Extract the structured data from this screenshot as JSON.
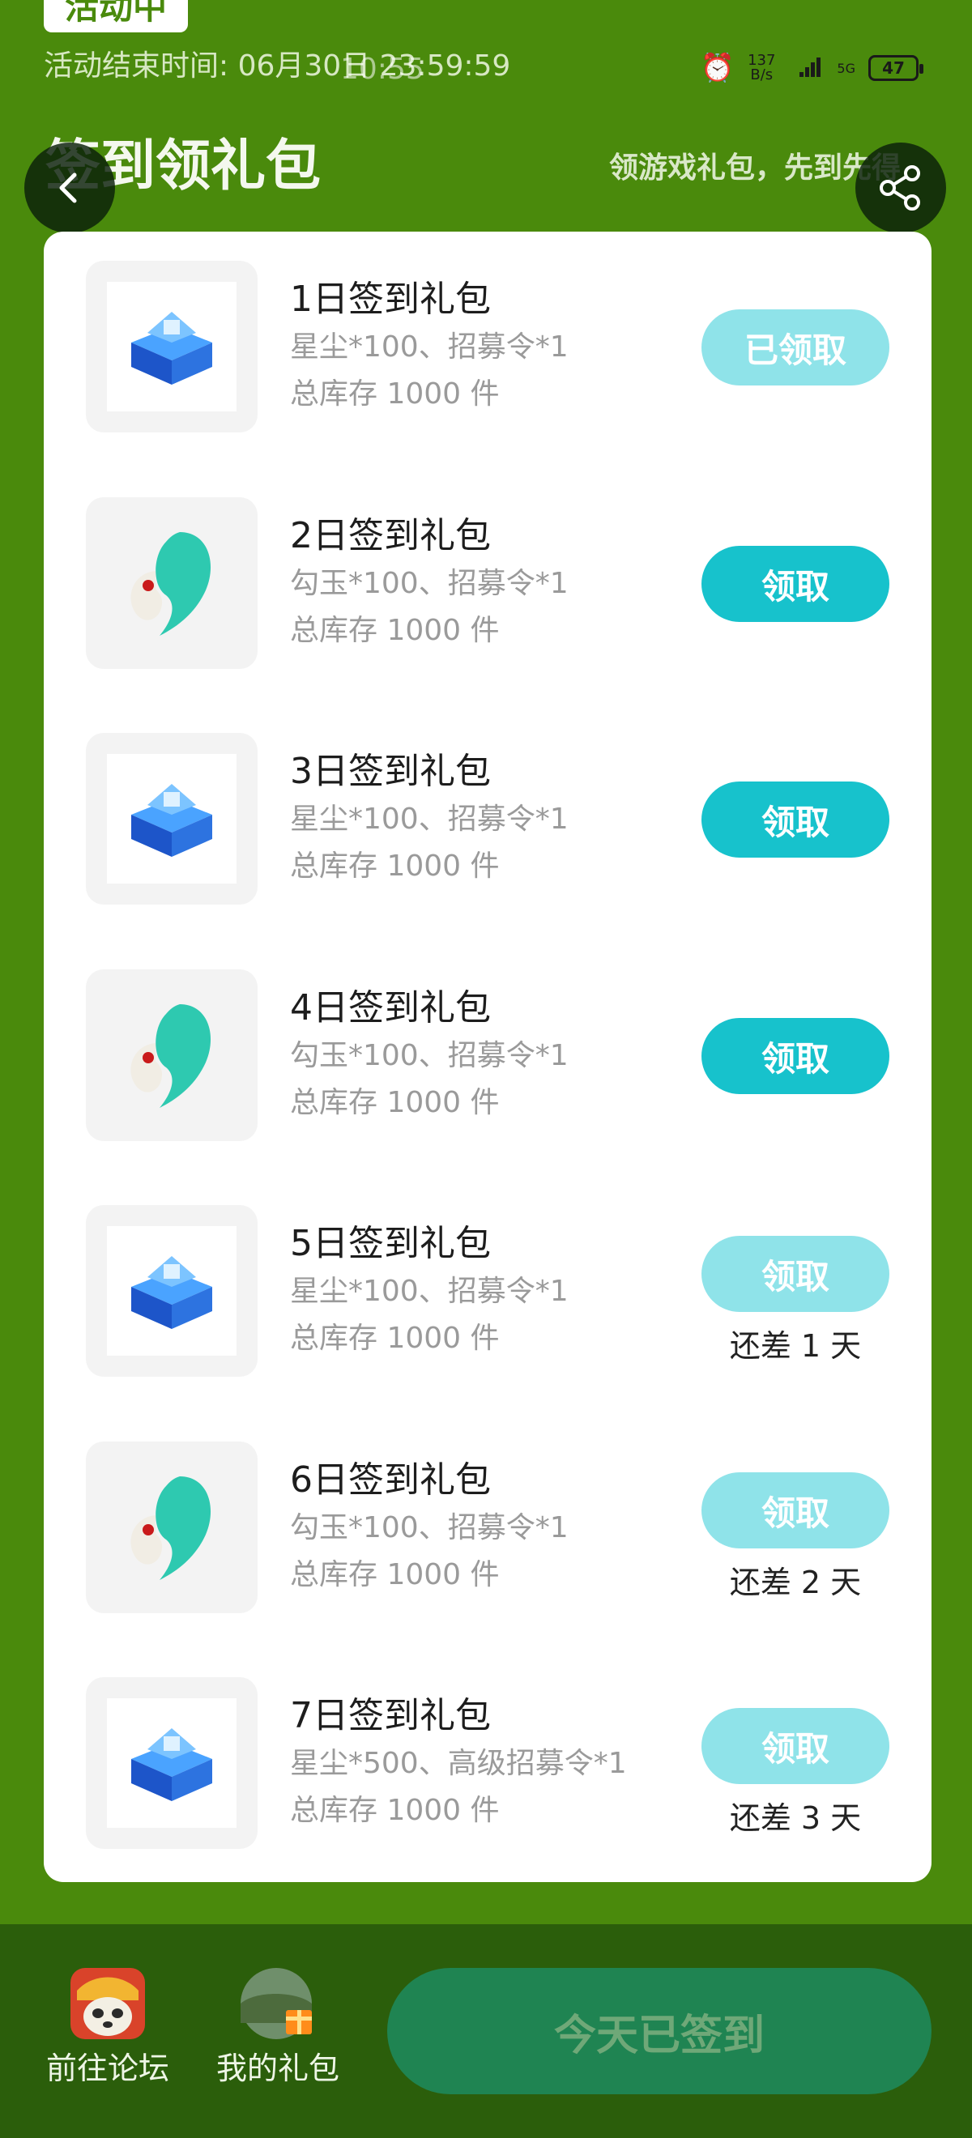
{
  "status": {
    "clock": "10:55",
    "speed_value": "137",
    "speed_unit": "B/s",
    "network": "5G",
    "battery": "47"
  },
  "header": {
    "badge": "活动中",
    "end_time": "活动结束时间: 06月30日 23:59:59",
    "title": "签到领礼包",
    "subtitle": "领游戏礼包，先到先得"
  },
  "icons": {
    "back": "back-arrow-icon",
    "share": "share-icon",
    "stardust": "blue-treasure-chest-icon",
    "magatama": "jade-magatama-icon"
  },
  "gifts": [
    {
      "name": "1日签到礼包",
      "desc": "星尘*100、招募令*1",
      "stock": "总库存 1000 件",
      "button": "已领取",
      "state": "done",
      "remain": ""
    },
    {
      "name": "2日签到礼包",
      "desc": "勾玉*100、招募令*1",
      "stock": "总库存 1000 件",
      "button": "领取",
      "state": "active",
      "remain": ""
    },
    {
      "name": "3日签到礼包",
      "desc": "星尘*100、招募令*1",
      "stock": "总库存 1000 件",
      "button": "领取",
      "state": "active",
      "remain": ""
    },
    {
      "name": "4日签到礼包",
      "desc": "勾玉*100、招募令*1",
      "stock": "总库存 1000 件",
      "button": "领取",
      "state": "active",
      "remain": ""
    },
    {
      "name": "5日签到礼包",
      "desc": "星尘*100、招募令*1",
      "stock": "总库存 1000 件",
      "button": "领取",
      "state": "pending",
      "remain": "还差 1 天"
    },
    {
      "name": "6日签到礼包",
      "desc": "勾玉*100、招募令*1",
      "stock": "总库存 1000 件",
      "button": "领取",
      "state": "pending",
      "remain": "还差 2 天"
    },
    {
      "name": "7日签到礼包",
      "desc": "星尘*500、高级招募令*1",
      "stock": "总库存 1000 件",
      "button": "领取",
      "state": "pending",
      "remain": "还差 3 天"
    }
  ],
  "bottom": {
    "forum_label": "前往论坛",
    "gifts_label": "我的礼包",
    "signin_label": "今天已签到"
  },
  "colors": {
    "background": "#4a8a0c",
    "button_active": "#17c2cc",
    "button_disabled": "#8fe3e9",
    "signin": "#1f8452"
  }
}
